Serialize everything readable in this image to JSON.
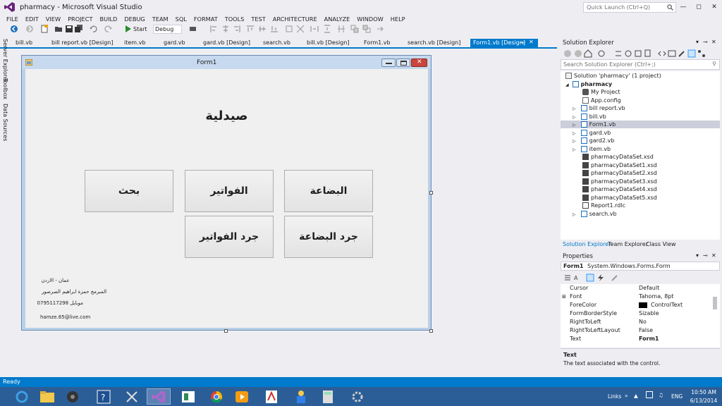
{
  "window": {
    "title": "pharmacy - Microsoft Visual Studio",
    "quick_launch_placeholder": "Quick Launch (Ctrl+Q)"
  },
  "menu": [
    "FILE",
    "EDIT",
    "VIEW",
    "PROJECT",
    "BUILD",
    "DEBUG",
    "TEAM",
    "SQL",
    "FORMAT",
    "TOOLS",
    "TEST",
    "ARCHITECTURE",
    "ANALYZE",
    "WINDOW",
    "HELP"
  ],
  "toolbar": {
    "start_label": "Start",
    "configuration": "Debug"
  },
  "doc_tabs": [
    "bill.vb",
    "bill report.vb [Design]",
    "item.vb",
    "gard.vb",
    "gard.vb [Design]",
    "search.vb",
    "bill.vb [Design]",
    "Form1.vb",
    "search.vb [Design]",
    "Form1.vb [Design]"
  ],
  "side_tabs": [
    "Server Explorer",
    "Toolbox",
    "Data Sources"
  ],
  "form": {
    "title": "Form1",
    "heading": "صيدلية",
    "buttons": {
      "search": "بحث",
      "invoices": "الفواتير",
      "goods": "البضاعة",
      "inventory_invoices": "جرد الفواتير",
      "inventory_goods": "جرد البضاعة"
    },
    "info": {
      "location": "عمان - الاردن",
      "programmer": "المبرمج حمزة ابراهيم الصرصور",
      "mobile": "موبايل 0795117298",
      "email": "hamze.85@live.com"
    }
  },
  "solution_explorer": {
    "title": "Solution Explorer",
    "search_placeholder": "Search Solution Explorer (Ctrl+;)",
    "solution": "Solution 'pharmacy' (1 project)",
    "project": "pharmacy",
    "items": [
      {
        "label": "My Project",
        "expandable": false
      },
      {
        "label": "App.config",
        "expandable": false
      },
      {
        "label": "bill report.vb",
        "expandable": true
      },
      {
        "label": "bill.vb",
        "expandable": true
      },
      {
        "label": "Form1.vb",
        "expandable": true,
        "selected": true
      },
      {
        "label": "gard.vb",
        "expandable": true
      },
      {
        "label": "gard2.vb",
        "expandable": true
      },
      {
        "label": "item.vb",
        "expandable": true
      },
      {
        "label": "pharmacyDataSet.xsd",
        "expandable": false
      },
      {
        "label": "pharmacyDataSet1.xsd",
        "expandable": false
      },
      {
        "label": "pharmacyDataSet2.xsd",
        "expandable": false
      },
      {
        "label": "pharmacyDataSet3.xsd",
        "expandable": false
      },
      {
        "label": "pharmacyDataSet4.xsd",
        "expandable": false
      },
      {
        "label": "pharmacyDataSet5.xsd",
        "expandable": false
      },
      {
        "label": "Report1.rdlc",
        "expandable": false
      },
      {
        "label": "search.vb",
        "expandable": true
      }
    ],
    "tabs": [
      "Solution Explorer",
      "Team Explorer",
      "Class View"
    ]
  },
  "properties": {
    "title": "Properties",
    "object_name": "Form1",
    "object_type": "System.Windows.Forms.Form",
    "rows": [
      {
        "name": "Cursor",
        "value": "Default"
      },
      {
        "name": "Font",
        "value": "Tahoma, 8pt"
      },
      {
        "name": "ForeColor",
        "value": "ControlText"
      },
      {
        "name": "FormBorderStyle",
        "value": "Sizable"
      },
      {
        "name": "RightToLeft",
        "value": "No"
      },
      {
        "name": "RightToLeftLayout",
        "value": "False"
      },
      {
        "name": "Text",
        "value": "Form1"
      }
    ],
    "description_title": "Text",
    "description": "The text associated with the control."
  },
  "status": "Ready",
  "taskbar": {
    "links_label": "Links",
    "language": "ENG",
    "time": "10:50 AM",
    "date": "6/13/2014"
  },
  "colors": {
    "accent": "#007ACC",
    "taskbar": "#2B5E97",
    "form_border": "#B9D1EA"
  }
}
